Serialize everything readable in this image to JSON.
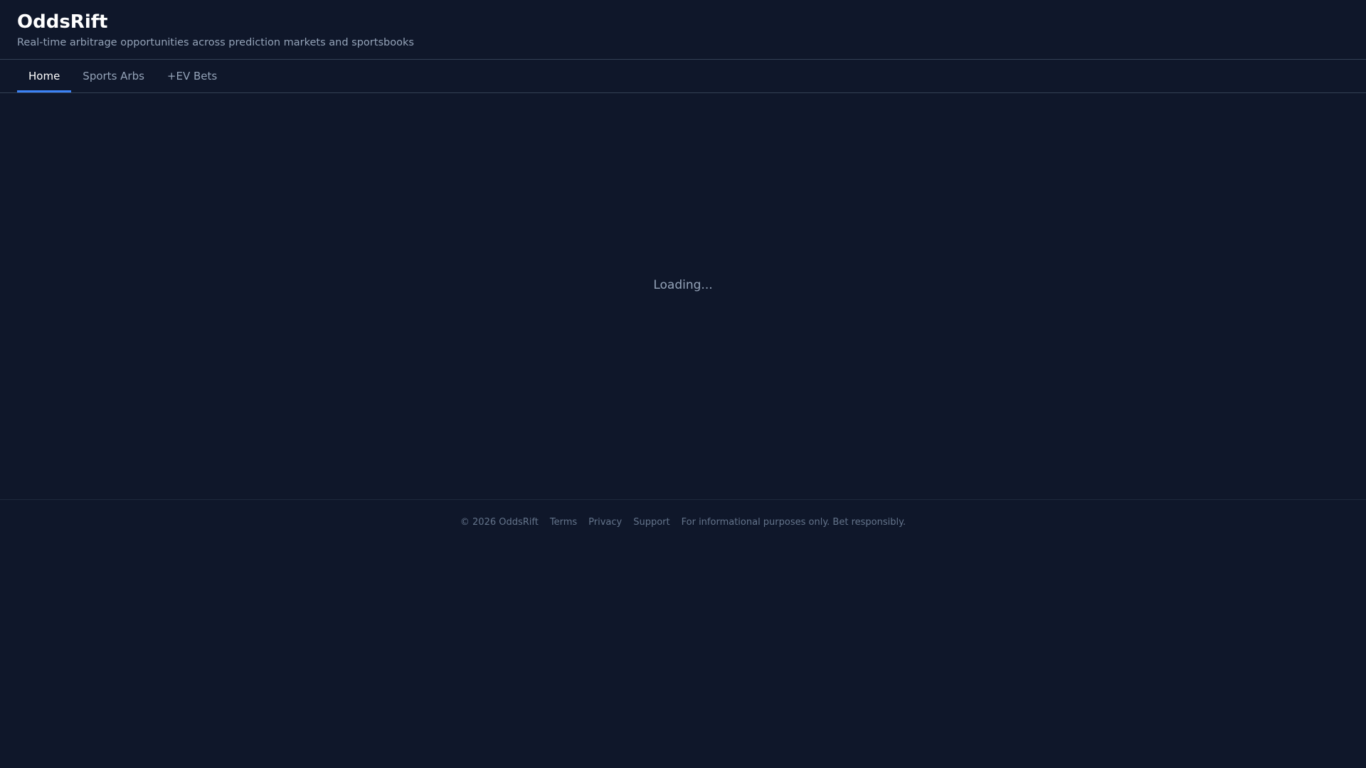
{
  "header": {
    "title": "OddsRift",
    "subtitle": "Real-time arbitrage opportunities across prediction markets and sportsbooks"
  },
  "tabs": [
    {
      "label": "Home",
      "active": true
    },
    {
      "label": "Sports Arbs",
      "active": false
    },
    {
      "label": "+EV Bets",
      "active": false
    }
  ],
  "main": {
    "loading_text": "Loading..."
  },
  "footer": {
    "copyright": "© 2026 OddsRift",
    "links": [
      "Terms",
      "Privacy",
      "Support"
    ],
    "disclaimer": "For informational purposes only. Bet responsibly."
  },
  "colors": {
    "background": "#0f172a",
    "accent": "#3b82f6",
    "muted": "#94a3b8",
    "border": "#334155"
  }
}
